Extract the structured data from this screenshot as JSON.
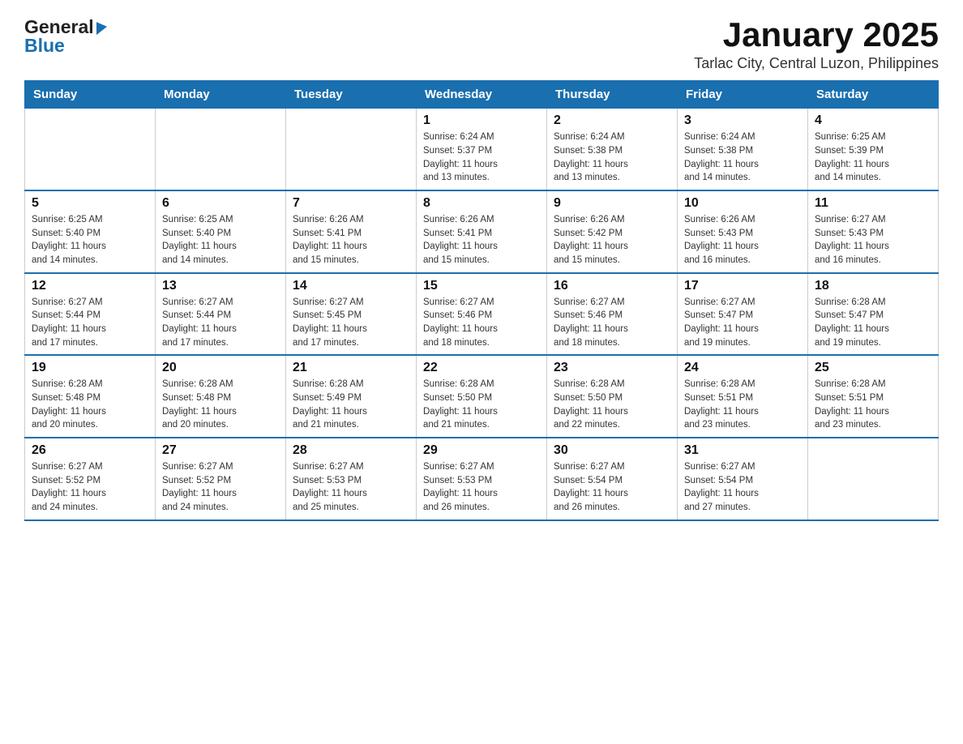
{
  "logo": {
    "general": "General",
    "blue": "Blue"
  },
  "title": "January 2025",
  "subtitle": "Tarlac City, Central Luzon, Philippines",
  "weekdays": [
    "Sunday",
    "Monday",
    "Tuesday",
    "Wednesday",
    "Thursday",
    "Friday",
    "Saturday"
  ],
  "weeks": [
    [
      {
        "day": "",
        "info": ""
      },
      {
        "day": "",
        "info": ""
      },
      {
        "day": "",
        "info": ""
      },
      {
        "day": "1",
        "info": "Sunrise: 6:24 AM\nSunset: 5:37 PM\nDaylight: 11 hours\nand 13 minutes."
      },
      {
        "day": "2",
        "info": "Sunrise: 6:24 AM\nSunset: 5:38 PM\nDaylight: 11 hours\nand 13 minutes."
      },
      {
        "day": "3",
        "info": "Sunrise: 6:24 AM\nSunset: 5:38 PM\nDaylight: 11 hours\nand 14 minutes."
      },
      {
        "day": "4",
        "info": "Sunrise: 6:25 AM\nSunset: 5:39 PM\nDaylight: 11 hours\nand 14 minutes."
      }
    ],
    [
      {
        "day": "5",
        "info": "Sunrise: 6:25 AM\nSunset: 5:40 PM\nDaylight: 11 hours\nand 14 minutes."
      },
      {
        "day": "6",
        "info": "Sunrise: 6:25 AM\nSunset: 5:40 PM\nDaylight: 11 hours\nand 14 minutes."
      },
      {
        "day": "7",
        "info": "Sunrise: 6:26 AM\nSunset: 5:41 PM\nDaylight: 11 hours\nand 15 minutes."
      },
      {
        "day": "8",
        "info": "Sunrise: 6:26 AM\nSunset: 5:41 PM\nDaylight: 11 hours\nand 15 minutes."
      },
      {
        "day": "9",
        "info": "Sunrise: 6:26 AM\nSunset: 5:42 PM\nDaylight: 11 hours\nand 15 minutes."
      },
      {
        "day": "10",
        "info": "Sunrise: 6:26 AM\nSunset: 5:43 PM\nDaylight: 11 hours\nand 16 minutes."
      },
      {
        "day": "11",
        "info": "Sunrise: 6:27 AM\nSunset: 5:43 PM\nDaylight: 11 hours\nand 16 minutes."
      }
    ],
    [
      {
        "day": "12",
        "info": "Sunrise: 6:27 AM\nSunset: 5:44 PM\nDaylight: 11 hours\nand 17 minutes."
      },
      {
        "day": "13",
        "info": "Sunrise: 6:27 AM\nSunset: 5:44 PM\nDaylight: 11 hours\nand 17 minutes."
      },
      {
        "day": "14",
        "info": "Sunrise: 6:27 AM\nSunset: 5:45 PM\nDaylight: 11 hours\nand 17 minutes."
      },
      {
        "day": "15",
        "info": "Sunrise: 6:27 AM\nSunset: 5:46 PM\nDaylight: 11 hours\nand 18 minutes."
      },
      {
        "day": "16",
        "info": "Sunrise: 6:27 AM\nSunset: 5:46 PM\nDaylight: 11 hours\nand 18 minutes."
      },
      {
        "day": "17",
        "info": "Sunrise: 6:27 AM\nSunset: 5:47 PM\nDaylight: 11 hours\nand 19 minutes."
      },
      {
        "day": "18",
        "info": "Sunrise: 6:28 AM\nSunset: 5:47 PM\nDaylight: 11 hours\nand 19 minutes."
      }
    ],
    [
      {
        "day": "19",
        "info": "Sunrise: 6:28 AM\nSunset: 5:48 PM\nDaylight: 11 hours\nand 20 minutes."
      },
      {
        "day": "20",
        "info": "Sunrise: 6:28 AM\nSunset: 5:48 PM\nDaylight: 11 hours\nand 20 minutes."
      },
      {
        "day": "21",
        "info": "Sunrise: 6:28 AM\nSunset: 5:49 PM\nDaylight: 11 hours\nand 21 minutes."
      },
      {
        "day": "22",
        "info": "Sunrise: 6:28 AM\nSunset: 5:50 PM\nDaylight: 11 hours\nand 21 minutes."
      },
      {
        "day": "23",
        "info": "Sunrise: 6:28 AM\nSunset: 5:50 PM\nDaylight: 11 hours\nand 22 minutes."
      },
      {
        "day": "24",
        "info": "Sunrise: 6:28 AM\nSunset: 5:51 PM\nDaylight: 11 hours\nand 23 minutes."
      },
      {
        "day": "25",
        "info": "Sunrise: 6:28 AM\nSunset: 5:51 PM\nDaylight: 11 hours\nand 23 minutes."
      }
    ],
    [
      {
        "day": "26",
        "info": "Sunrise: 6:27 AM\nSunset: 5:52 PM\nDaylight: 11 hours\nand 24 minutes."
      },
      {
        "day": "27",
        "info": "Sunrise: 6:27 AM\nSunset: 5:52 PM\nDaylight: 11 hours\nand 24 minutes."
      },
      {
        "day": "28",
        "info": "Sunrise: 6:27 AM\nSunset: 5:53 PM\nDaylight: 11 hours\nand 25 minutes."
      },
      {
        "day": "29",
        "info": "Sunrise: 6:27 AM\nSunset: 5:53 PM\nDaylight: 11 hours\nand 26 minutes."
      },
      {
        "day": "30",
        "info": "Sunrise: 6:27 AM\nSunset: 5:54 PM\nDaylight: 11 hours\nand 26 minutes."
      },
      {
        "day": "31",
        "info": "Sunrise: 6:27 AM\nSunset: 5:54 PM\nDaylight: 11 hours\nand 27 minutes."
      },
      {
        "day": "",
        "info": ""
      }
    ]
  ]
}
